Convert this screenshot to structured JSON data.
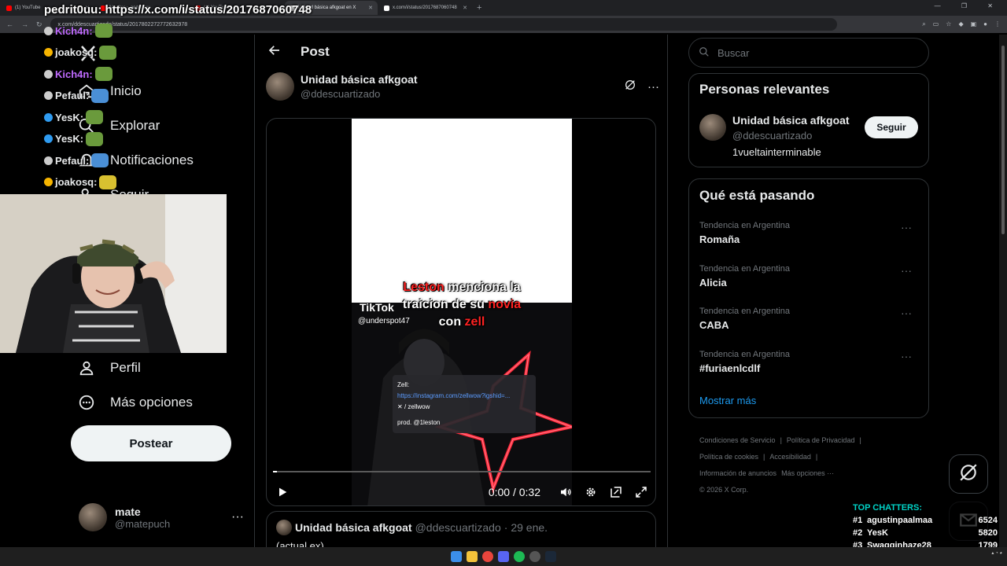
{
  "browser": {
    "tabs": [
      {
        "label": "(1) YouTube",
        "fav": "#ff0000",
        "active": false
      },
      {
        "label": "Monitor ~ pedrit0uu",
        "fav": "#ff0000",
        "active": false
      },
      {
        "label": "(1) YouTube",
        "fav": "#ff0000",
        "active": false
      },
      {
        "label": "Unidad básica afkgoat en X",
        "fav": "#ffffff",
        "active": true
      },
      {
        "label": "x.com/i/status/2017687060748",
        "fav": "#ffffff",
        "active": false
      }
    ],
    "new_tab": "+",
    "url": "x.com/ddescuartizado/status/2017802272772632978"
  },
  "stream": {
    "url_overlay": "pedrit0uu: https://x.com/i/status/2017687060748",
    "chat": [
      {
        "user": "Kich4n:",
        "color": "#c06bff",
        "badge": "#cccccc",
        "emote": "#6a9a3c"
      },
      {
        "user": "joakosq:",
        "color": "#e7e9ea",
        "badge": "#f6b400",
        "emote": "#6a9a3c"
      },
      {
        "user": "Kich4n:",
        "color": "#c06bff",
        "badge": "#cccccc",
        "emote": "#6a9a3c"
      },
      {
        "user": "Pefaul:",
        "color": "#e7e9ea",
        "badge": "#cccccc",
        "emote": "#4a8fd6"
      },
      {
        "user": "YesK:",
        "color": "#e7e9ea",
        "badge": "#2f9bf0",
        "emote": "#6a9a3c"
      },
      {
        "user": "YesK:",
        "color": "#e7e9ea",
        "badge": "#2f9bf0",
        "emote": "#6a9a3c"
      },
      {
        "user": "Pefaul:",
        "color": "#e7e9ea",
        "badge": "#cccccc",
        "emote": "#4a8fd6"
      },
      {
        "user": "joakosq:",
        "color": "#e7e9ea",
        "badge": "#f6b400",
        "emote": "#d8c030"
      }
    ],
    "top_chatters_title": "TOP CHATTERS:",
    "top_chatters": [
      {
        "rank": "#1",
        "name": "agustinpaalmaa",
        "score": "6524"
      },
      {
        "rank": "#2",
        "name": "YesK",
        "score": "5820"
      },
      {
        "rank": "#3",
        "name": "Swagginhaze28",
        "score": "1799"
      }
    ]
  },
  "nav": {
    "items": [
      {
        "label": "Inicio",
        "icon": "home-icon"
      },
      {
        "label": "Explorar",
        "icon": "search-icon"
      },
      {
        "label": "Notificaciones",
        "icon": "bell-icon"
      },
      {
        "label": "Seguir",
        "icon": "follow-icon"
      },
      {
        "label": "Perfil",
        "icon": "profile-icon"
      },
      {
        "label": "Más opciones",
        "icon": "more-icon"
      }
    ],
    "post_button": "Postear",
    "account": {
      "name": "mate",
      "handle": "@matepuch",
      "more": "···"
    }
  },
  "post": {
    "header_title": "Post",
    "author_name": "Unidad básica afkgoat",
    "author_handle": "@ddescuartizado",
    "more": "···",
    "video": {
      "caption_part1": "Leston",
      "caption_part2": " menciona la",
      "caption_part3": "traicion de su ",
      "caption_part4": "novia",
      "caption_part5": "con ",
      "caption_part6": "zell",
      "watermark": "TikTok",
      "tiktok_handle": "@underspot47",
      "link_title": "Zell:",
      "link_url": "https://instagram.com/zellwow?igshid=...",
      "link_x": "/ zellwow",
      "link_prod": "prod. @1leston",
      "time": "0:00 / 0:32",
      "progress": 0.01
    },
    "quote": {
      "name": "Unidad básica afkgoat",
      "handle": "@ddescuartizado",
      "date": "· 29 ene.",
      "text": "(actual ex)"
    }
  },
  "sidebar": {
    "search_placeholder": "Buscar",
    "relevant_title": "Personas relevantes",
    "relevant_person": {
      "name": "Unidad básica afkgoat",
      "handle": "@ddescuartizado",
      "bio": "1vueltainterminable",
      "follow": "Seguir"
    },
    "trending_title": "Qué está pasando",
    "trends": [
      {
        "meta": "Tendencia en Argentina",
        "term": "Romaña"
      },
      {
        "meta": "Tendencia en Argentina",
        "term": "Alicia"
      },
      {
        "meta": "Tendencia en Argentina",
        "term": "CABA"
      },
      {
        "meta": "Tendencia en Argentina",
        "term": "#furiaenlcdlf"
      }
    ],
    "trend_more": "···",
    "show_more": "Mostrar más",
    "footer": {
      "terms": "Condiciones de Servicio",
      "privacy": "Política de Privacidad",
      "cookies": "Política de cookies",
      "accessibility": "Accesibilidad",
      "ads": "Información de anuncios",
      "more": "Más opciones ···",
      "copyright": "© 2026 X Corp."
    }
  },
  "colors": {
    "accent": "#1d9bf0",
    "text": "#e7e9ea",
    "muted": "#71767b",
    "border": "#2f3336",
    "caption_red": "#ff2222",
    "chatters_title": "#00d3c7"
  }
}
